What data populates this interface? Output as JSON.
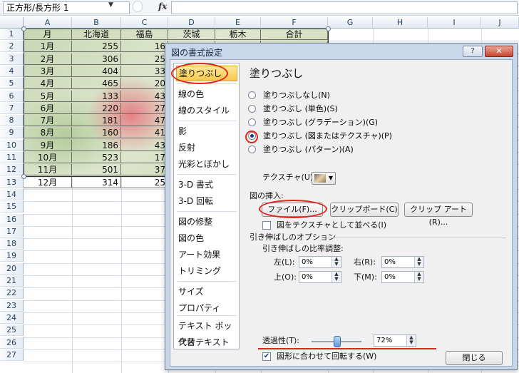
{
  "formula_bar": {
    "name_box": "正方形/長方形 1",
    "fx": "fx"
  },
  "columns": [
    "A",
    "B",
    "C",
    "D",
    "E",
    "F",
    "G",
    "H",
    "I",
    "J"
  ],
  "rows": [
    "1",
    "2",
    "3",
    "4",
    "5",
    "6",
    "7",
    "8",
    "9",
    "10",
    "11",
    "12",
    "13",
    "14",
    "15",
    "16",
    "17",
    "18",
    "19",
    "20",
    "21",
    "22",
    "23",
    "24",
    "25",
    "26",
    "27"
  ],
  "table": {
    "headers": [
      "月",
      "北海道",
      "福島",
      "茨城",
      "栃木",
      "合計"
    ],
    "months": [
      "1月",
      "2月",
      "3月",
      "4月",
      "5月",
      "6月",
      "7月",
      "8月",
      "9月",
      "10月",
      "11月",
      "12月"
    ],
    "hokkaido": [
      "255",
      "306",
      "404",
      "465",
      "133",
      "220",
      "181",
      "160",
      "186",
      "523",
      "501",
      "314"
    ],
    "fukushima_partial": [
      "16",
      "25",
      "33",
      "20",
      "43",
      "27",
      "47",
      "41",
      "43",
      "17",
      "37",
      "25"
    ]
  },
  "dialog": {
    "title": "図の書式設定",
    "help": "?",
    "close_x": "✕",
    "nav": [
      "塗りつぶし",
      "線の色",
      "線のスタイル",
      "影",
      "反射",
      "光彩とぼかし",
      "3-D 書式",
      "3-D 回転",
      "図の修整",
      "図の色",
      "アート効果",
      "トリミング",
      "サイズ",
      "プロパティ",
      "テキスト ボックス",
      "代替テキスト"
    ],
    "panel_title": "塗りつぶし",
    "fill_options": [
      "塗りつぶしなし(N)",
      "塗りつぶし (単色)(S)",
      "塗りつぶし (グラデーション)(G)",
      "塗りつぶし (図またはテクスチャ)(P)",
      "塗りつぶし (パターン)(A)"
    ],
    "selected_fill_index": 3,
    "texture_label": "テクスチャ(U):",
    "insert_label": "図の挿入:",
    "btn_file": "ファイル(F)...",
    "btn_clipboard": "クリップボード(C)",
    "btn_clipart": "クリップ アート(R)...",
    "tile_checkbox": "図をテクスチャとして並べる(I)",
    "tile_checked": false,
    "stretch_options": "引き伸ばしのオプション",
    "stretch_ratio": "引き伸ばしの比率調整:",
    "left_label": "左(L):",
    "left_value": "0%",
    "right_label": "右(R):",
    "right_value": "0%",
    "top_label": "上(O):",
    "top_value": "0%",
    "bottom_label": "下(M):",
    "bottom_value": "0%",
    "transparency_label": "透過性(T):",
    "transparency_value": "72%",
    "transparency_fraction": 0.72,
    "rotate_checkbox": "図形に合わせて回転する(W)",
    "rotate_checked": true,
    "close_button": "閉じる"
  },
  "colors": {
    "accent_red": "#e3241d",
    "nav_selected": "#f7c84b"
  }
}
